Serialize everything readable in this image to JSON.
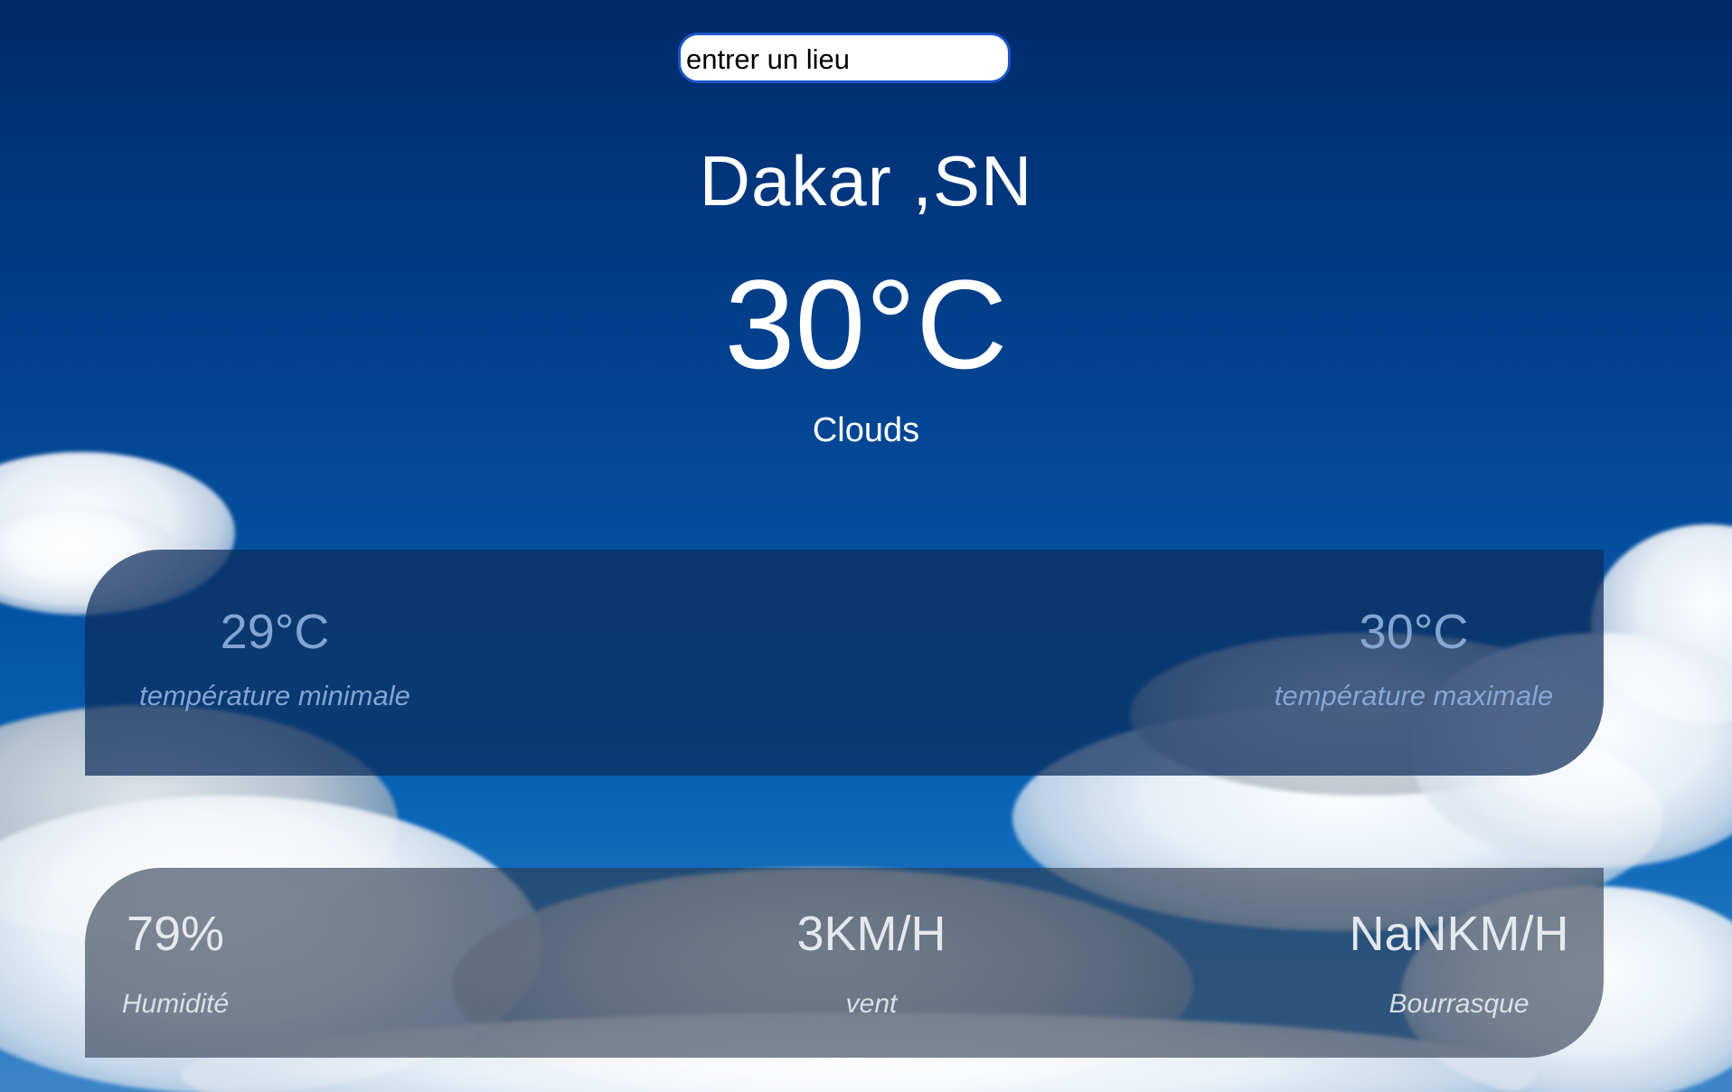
{
  "search": {
    "placeholder": "entrer un lieu"
  },
  "location": {
    "city": "Dakar ,SN"
  },
  "current": {
    "temperature": "30°C",
    "condition": "Clouds"
  },
  "temperature_range": {
    "min_value": "29°C",
    "min_label": "température minimale",
    "max_value": "30°C",
    "max_label": "température maximale"
  },
  "details": {
    "humidity_value": "79%",
    "humidity_label": "Humidité",
    "wind_value": "3KM/H",
    "wind_label": "vent",
    "gust_value": "NaNKM/H",
    "gust_label": "Bourrasque"
  },
  "colors": {
    "sky_top": "#002a6b",
    "sky_bottom": "#3d86c8",
    "input_border": "#1b55c9"
  }
}
